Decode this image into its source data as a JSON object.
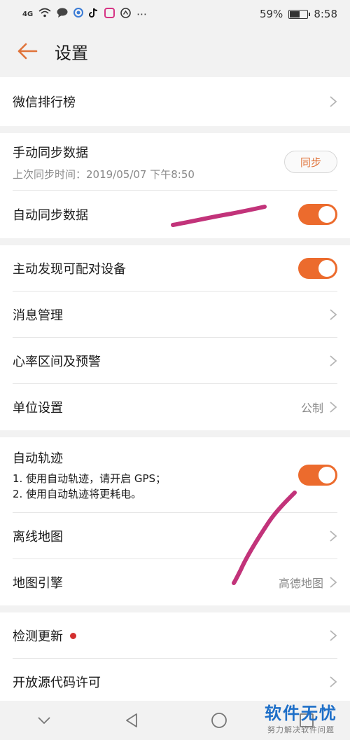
{
  "status_bar": {
    "network": "4G",
    "more": "⋯",
    "battery_percent": "59%",
    "battery_level": 0.59,
    "time": "8:58"
  },
  "header": {
    "title": "设置"
  },
  "settings": {
    "wechat_rank": {
      "label": "微信排行榜"
    },
    "manual_sync": {
      "label": "手动同步数据",
      "last_sync": "上次同步时间：2019/05/07 下午8:50",
      "button_label": "同步"
    },
    "auto_sync": {
      "label": "自动同步数据",
      "enabled": true
    },
    "discover_devices": {
      "label": "主动发现可配对设备",
      "enabled": true
    },
    "message_mgmt": {
      "label": "消息管理"
    },
    "heart_rate": {
      "label": "心率区间及预警"
    },
    "units": {
      "label": "单位设置",
      "value": "公制"
    },
    "auto_track": {
      "label": "自动轨迹",
      "note_1": "1. 使用自动轨迹，请开启 GPS；",
      "note_2": "2. 使用自动轨迹将更耗电。",
      "enabled": true
    },
    "offline_map": {
      "label": "离线地图"
    },
    "map_engine": {
      "label": "地图引擎",
      "value": "高德地图"
    },
    "check_update": {
      "label": "检测更新"
    },
    "open_source": {
      "label": "开放源代码许可"
    }
  },
  "watermark": {
    "main": "软件无忧",
    "sub": "努力解决软件问题"
  },
  "colors": {
    "accent": "#ec6b2d",
    "annotation": "#c2337a",
    "watermark": "#1e6fc8"
  }
}
